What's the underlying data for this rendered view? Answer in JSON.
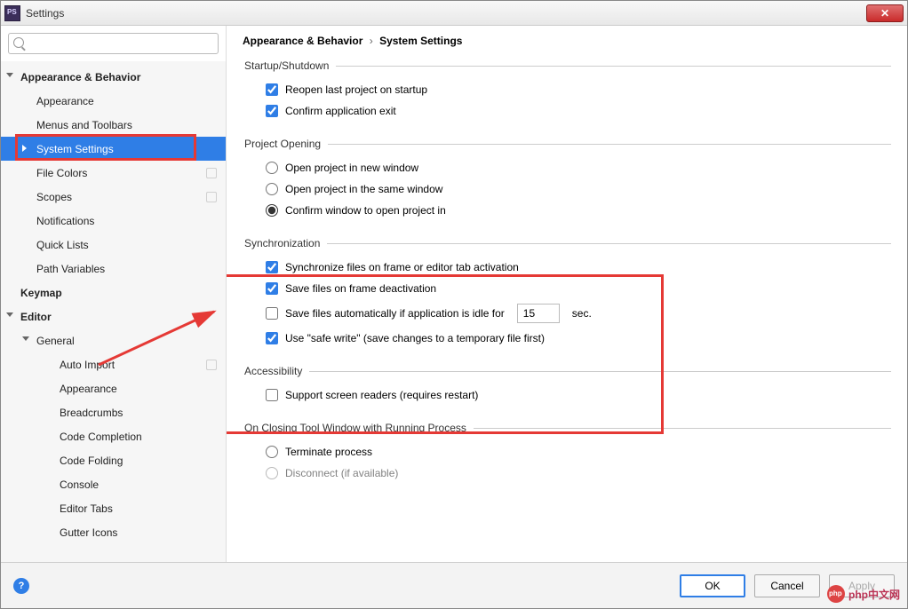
{
  "window": {
    "title": "Settings"
  },
  "search": {
    "placeholder": ""
  },
  "tree": {
    "appearance_behavior": "Appearance & Behavior",
    "appearance": "Appearance",
    "menus_toolbars": "Menus and Toolbars",
    "system_settings": "System Settings",
    "file_colors": "File Colors",
    "scopes": "Scopes",
    "notifications": "Notifications",
    "quick_lists": "Quick Lists",
    "path_variables": "Path Variables",
    "keymap": "Keymap",
    "editor": "Editor",
    "general": "General",
    "auto_import": "Auto Import",
    "appearance2": "Appearance",
    "breadcrumbs": "Breadcrumbs",
    "code_completion": "Code Completion",
    "code_folding": "Code Folding",
    "console": "Console",
    "editor_tabs": "Editor Tabs",
    "gutter_icons": "Gutter Icons"
  },
  "breadcrumb": {
    "parent": "Appearance & Behavior",
    "current": "System Settings"
  },
  "sections": {
    "startup": {
      "legend": "Startup/Shutdown",
      "reopen": "Reopen last project on startup",
      "confirm_exit": "Confirm application exit"
    },
    "opening": {
      "legend": "Project Opening",
      "new_window": "Open project in new window",
      "same_window": "Open project in the same window",
      "confirm": "Confirm window to open project in"
    },
    "sync": {
      "legend": "Synchronization",
      "sync_frame": "Synchronize files on frame or editor tab activation",
      "save_frame": "Save files on frame deactivation",
      "save_idle_before": "Save files automatically if application is idle for",
      "idle_value": "15",
      "save_idle_after": "sec.",
      "safe_write": "Use \"safe write\" (save changes to a temporary file first)"
    },
    "access": {
      "legend": "Accessibility",
      "screen_readers": "Support screen readers (requires restart)"
    },
    "closing": {
      "legend": "On Closing Tool Window with Running Process",
      "terminate": "Terminate process",
      "disconnect": "Disconnect (if available)"
    }
  },
  "buttons": {
    "ok": "OK",
    "cancel": "Cancel",
    "apply": "Apply"
  },
  "watermark": "php中文网"
}
